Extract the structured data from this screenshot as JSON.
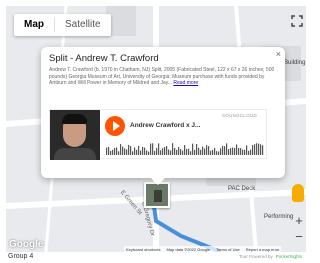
{
  "map": {
    "type_control": {
      "map_label": "Map",
      "satellite_label": "Satellite",
      "selected": "Map"
    },
    "labels": {
      "building": "Building",
      "pac_deck": "PAC Deck",
      "performing": "Performing"
    },
    "streets": {
      "e_green": "E Green St",
      "e_gregory": "E Gregory Dr"
    },
    "attribution": {
      "keyboard": "Keyboard shortcuts",
      "map_data": "Map data ©2022 Google",
      "terms": "Terms of Use",
      "report": "Report a map error"
    },
    "google_logo": "Google",
    "powered_by": "Tour Powered by",
    "pocketsights": "PocketSights"
  },
  "popup": {
    "title": "Split - Andrew T. Crawford",
    "close_label": "×",
    "description": "Andrew T. Crawford (b. 1970 in Chatham, NJ) Split, 2005 (Fabricated Steel, 122 x 67 x 26 inches; 500 pounds) Georgia Museum of Art, University of Georgia; Museum purchase with funds provided by Amburn and Will Power in Memory of Mildred and Jay...",
    "read_more": "Read more",
    "player": {
      "track": "Andrew Crawford x J...",
      "brand": "SOUNDCLOUD"
    }
  },
  "footer": {
    "caption": "Group 4"
  },
  "colors": {
    "soundcloud": "#ff5500",
    "route": "#4a90d9",
    "pegman": "#f9ab00"
  },
  "icons": [
    "fullscreen-icon",
    "close-icon",
    "play-icon",
    "pegman-icon",
    "zoom-in-icon",
    "zoom-out-icon"
  ]
}
